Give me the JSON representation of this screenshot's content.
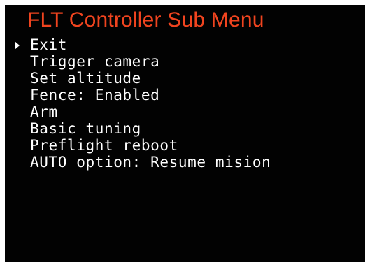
{
  "header": {
    "title": "FLT Controller Sub Menu"
  },
  "menu": {
    "items": [
      {
        "label": "Exit",
        "selected": true
      },
      {
        "label": "Trigger camera",
        "selected": false
      },
      {
        "label": "Set altitude",
        "selected": false
      },
      {
        "label": "Fence: Enabled",
        "selected": false
      },
      {
        "label": "Arm",
        "selected": false
      },
      {
        "label": "Basic tuning",
        "selected": false
      },
      {
        "label": "Preflight reboot",
        "selected": false
      },
      {
        "label": "AUTO option: Resume mision",
        "selected": false
      }
    ]
  },
  "icons": {
    "cursor": "selection-arrow-icon"
  },
  "colors": {
    "background": "#020202",
    "title": "#f0441f",
    "text": "#ffffff",
    "cursor": "#ffffff"
  }
}
